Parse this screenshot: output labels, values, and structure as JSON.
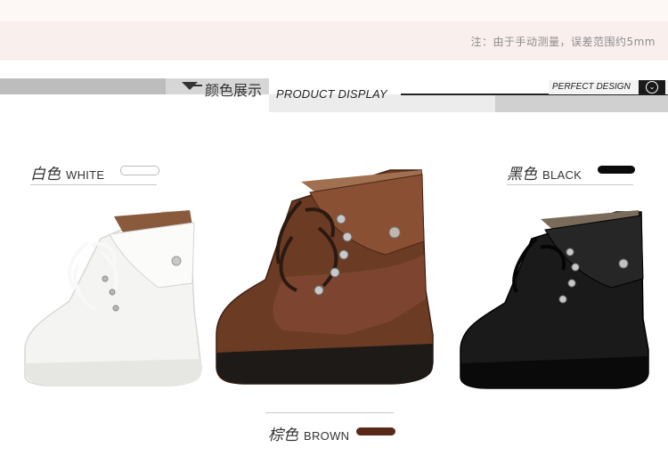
{
  "note": "注：由于手动测量，误差范围约5mm",
  "header": {
    "cn_title": "颜色展示",
    "en_title": "PRODUCT DISPLAY",
    "tag": "PERFECT DESIGN"
  },
  "colors": {
    "white": {
      "cn": "白色",
      "en": "WHITE",
      "swatch": "#ffffff"
    },
    "black": {
      "cn": "黑色",
      "en": "BLACK",
      "swatch": "#0a0a0a"
    },
    "brown": {
      "cn": "棕色",
      "en": "BROWN",
      "swatch": "#5a2a18"
    }
  }
}
